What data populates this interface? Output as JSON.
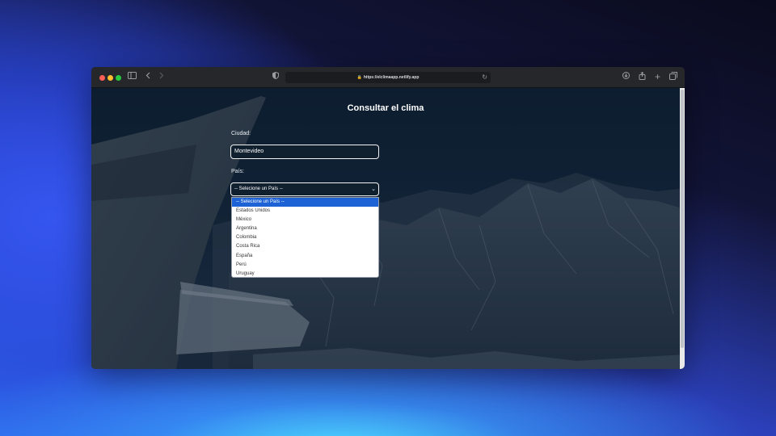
{
  "browser": {
    "url": "https://elclimaapp.netlify.app",
    "icons": [
      "sidebar-icon",
      "back-icon",
      "forward-icon",
      "shield-icon",
      "lock-icon",
      "reload-icon",
      "download-icon",
      "share-icon",
      "new-tab-icon",
      "tabs-overview-icon"
    ]
  },
  "page": {
    "title": "Consultar el clima",
    "city_label": "Ciudad:",
    "city_value": "Montevideo",
    "country_label": "País:",
    "country_selected": "-- Selecione un País --",
    "country_options": [
      "-- Selecione un País --",
      "Estados Unidos",
      "México",
      "Argentina",
      "Colombia",
      "Costa Rica",
      "España",
      "Perú",
      "Uruguay"
    ]
  },
  "colors": {
    "highlight": "#1d63d6",
    "close": "#ff5f57",
    "minimize": "#febc2e",
    "maximize": "#28c840"
  }
}
